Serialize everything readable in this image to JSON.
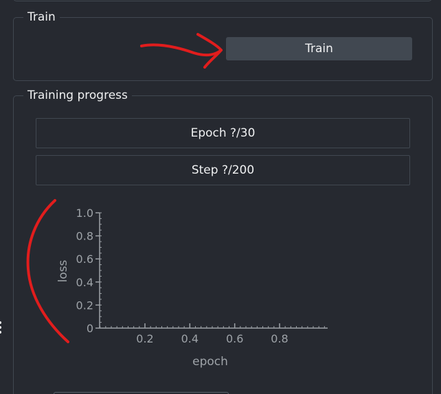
{
  "train_section": {
    "title": "Train",
    "train_button_label": "Train"
  },
  "progress_section": {
    "title": "Training progress",
    "epoch_text": "Epoch ?/30",
    "epoch_progress": 0,
    "step_text": "Step ?/200",
    "step_progress": 0
  },
  "chart_data": {
    "type": "line",
    "title": "",
    "xlabel": "epoch",
    "ylabel": "loss",
    "xlim": [
      0,
      1
    ],
    "ylim": [
      0,
      1
    ],
    "x_ticks": [
      0.2,
      0.4,
      0.6,
      0.8
    ],
    "x_tick_labels": [
      "0.2",
      "0.4",
      "0.6",
      "0.8"
    ],
    "y_ticks": [
      0,
      0.2,
      0.4,
      0.6,
      0.8,
      1.0
    ],
    "y_tick_labels": [
      "0",
      "0.2",
      "0.4",
      "0.6",
      "0.8",
      "1.0"
    ],
    "series": [],
    "grid": false
  },
  "colors": {
    "background": "#262930",
    "panel_border": "#414851",
    "button": "#414851",
    "text": "#f0f1f2",
    "axis": "#9ea3a8",
    "annotation": "#e11d1d"
  }
}
